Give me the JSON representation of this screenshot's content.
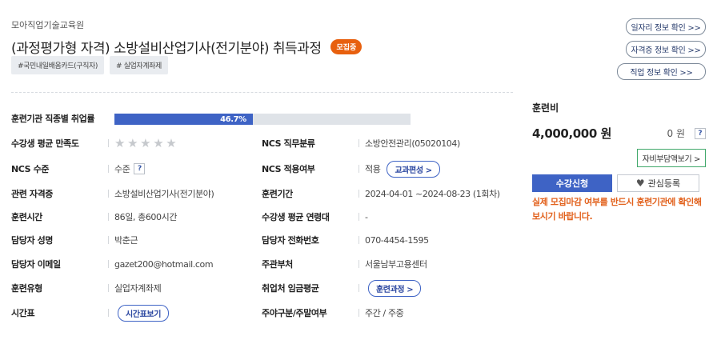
{
  "institution": "모아직업기술교육원",
  "title": "(과정평가형 자격) 소방설비산업기사(전기분야) 취득과정",
  "recruit_badge": "모집중",
  "tags": [
    "#국민내일배움카드(구직자)",
    "# 실업자계좌제"
  ],
  "links": {
    "job_info": "일자리 정보 확인 >>",
    "cert_info": "자격증 정보 확인 >>",
    "occupation_info": "직업 정보 확인 >>"
  },
  "details": {
    "employment_rate_label": "훈련기관 직종별 취업률",
    "employment_rate_value": "46.7%",
    "employment_rate_fraction": 0.467,
    "satisfaction_label": "수강생 평균 만족도",
    "satisfaction_stars": 0,
    "ncs_category_label": "NCS 직무분류",
    "ncs_category_value": "소방안전관리(05020104)",
    "ncs_level_label": "NCS 수준",
    "ncs_level_value": "수준",
    "ncs_apply_label": "NCS 적용여부",
    "ncs_apply_value": "적용",
    "curriculum_button": "교과편성 >",
    "related_cert_label": "관련 자격증",
    "related_cert_value": "소방설비산업기사(전기분야)",
    "period_label": "훈련기간",
    "period_value": "2024-04-01 ~2024-08-23 (1회차)",
    "hours_label": "훈련시간",
    "hours_value": "86일, 총600시간",
    "avg_age_label": "수강생 평균 연령대",
    "avg_age_value": "-",
    "manager_name_label": "담당자 성명",
    "manager_name_value": "박춘근",
    "manager_phone_label": "담당자 전화번호",
    "manager_phone_value": "070-4454-1595",
    "manager_email_label": "담당자 이메일",
    "manager_email_value": "gazet200@hotmail.com",
    "supervisor_label": "주관부처",
    "supervisor_value": "서울남부고용센터",
    "training_type_label": "훈련유형",
    "training_type_value": "실업자계좌제",
    "avg_wage_label": "취업처 임금평균",
    "training_course_button": "훈련과정 >",
    "timetable_label": "시간표",
    "timetable_button": "시간표보기",
    "day_night_label": "주야구분/주말여부",
    "day_night_value": "주간 / 주중"
  },
  "fee": {
    "label": "훈련비",
    "amount": "4,000,000 원",
    "self_pay": "0 원",
    "help": "?",
    "self_pay_button": "자비부담액보기 >"
  },
  "actions": {
    "apply": "수강신청",
    "favorite": "관심등록"
  },
  "notice": "실제 모집마감 여부를 반드시 훈련기관에 확인해보시기 바랍니다.",
  "colors": {
    "accent": "#3e63c5",
    "badge": "#e8600e",
    "notice": "#e2611c",
    "self_pay_border": "#40a86a"
  }
}
